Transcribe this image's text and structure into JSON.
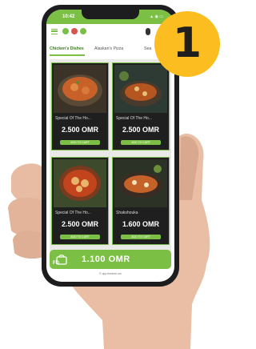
{
  "status_bar": {
    "time": "10:42",
    "signal": "▲ ◉ ▭"
  },
  "tabs": [
    "Chicken's Dishes",
    "Alaskan's Pizza",
    "Sea"
  ],
  "cards": [
    {
      "name": "Special Of The Ho...",
      "price": "2.500 OMR",
      "button": "ADD TO CART"
    },
    {
      "name": "Special Of The Ho...",
      "price": "2.500 OMR",
      "button": "ADD TO CART"
    },
    {
      "name": "Special Of The Ho...",
      "price": "2.500 OMR",
      "button": "ADD TO CART"
    },
    {
      "name": "Shakshouka",
      "price": "1.600 OMR",
      "button": "ADD TO CART"
    }
  ],
  "cart": {
    "count": "1",
    "total": "1.100 OMR",
    "logo": "FD"
  },
  "footer": "© app.feedme.om",
  "step_badge": "1",
  "colors": {
    "accent": "#7cbf45",
    "badge": "#fbbd20"
  }
}
